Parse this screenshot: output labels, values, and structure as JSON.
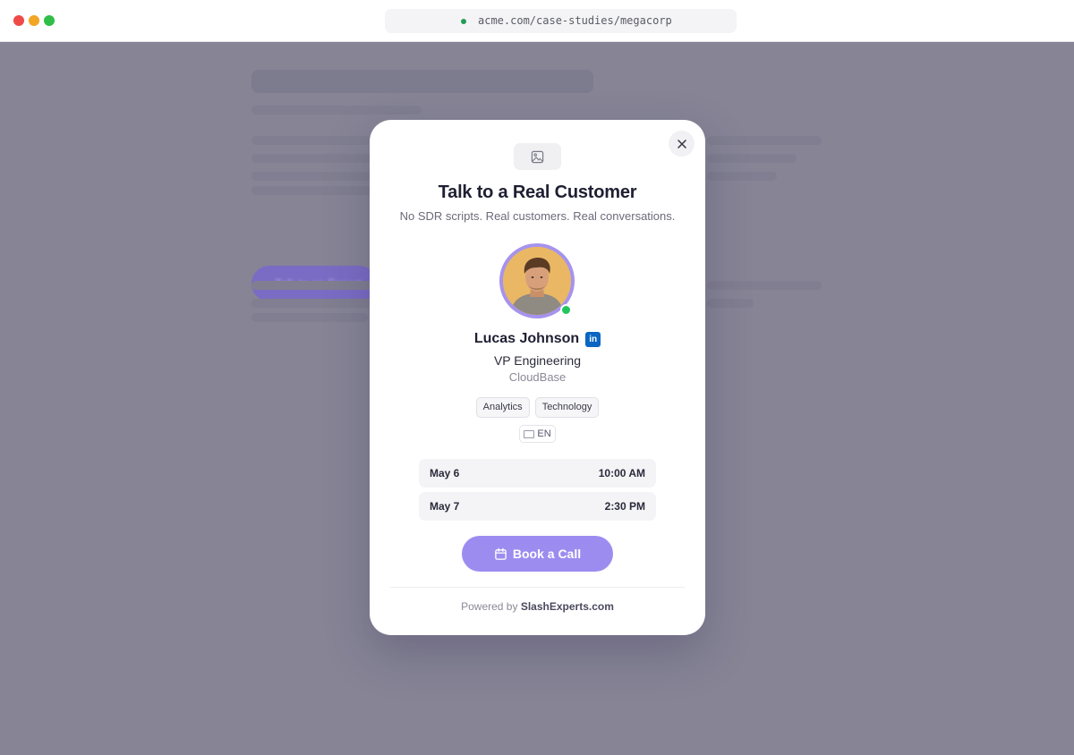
{
  "browser": {
    "url": "acme.com/case-studies/megacorp"
  },
  "background": {
    "button_label": "Talk to an Expert"
  },
  "modal": {
    "title": "Talk to a Real Customer",
    "subtitle": "No SDR scripts. Real customers. Real conversations.",
    "icons": {
      "close": "close-icon",
      "logo_placeholder": "image-icon",
      "linkedin": "linkedin-icon",
      "calendar": "calendar-icon",
      "flag": "flag-icon"
    },
    "expert": {
      "name": "Lucas Johnson",
      "linkedin_label": "in",
      "role": "VP Engineering",
      "company": "CloudBase",
      "status": "online",
      "tags": [
        "Analytics",
        "Technology"
      ],
      "language": "EN"
    },
    "slots": [
      {
        "date": "May 6",
        "time": "10:00 AM"
      },
      {
        "date": "May 7",
        "time": "2:30 PM"
      }
    ],
    "book_button": "Book a Call",
    "footer": {
      "prefix": "Powered by",
      "brand": "SlashExperts.com"
    }
  },
  "colors": {
    "accent": "#9d8cf0",
    "avatar_ring": "#a693ee",
    "online": "#22c55e",
    "linkedin": "#0a66c2",
    "overlay": "#858393"
  }
}
